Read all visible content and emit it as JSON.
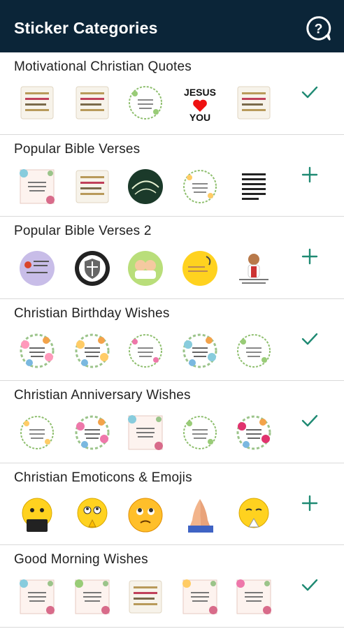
{
  "appbar": {
    "title": "Sticker Categories",
    "help_icon": "help-chat-icon",
    "background": "#0b2538"
  },
  "accent": "#1f8a73",
  "categories": [
    {
      "title": "Motivational Christian Quotes",
      "action": "added",
      "stickers": [
        {
          "label": "",
          "kind": "quote-card"
        },
        {
          "label": "Where GOD guides, He provides",
          "kind": "quote-card"
        },
        {
          "label": "",
          "kind": "wreath"
        },
        {
          "label": "JESUS ♥ YOU",
          "kind": "jesus-you"
        },
        {
          "label": "JESUS LOVES ME",
          "kind": "quote-card"
        }
      ]
    },
    {
      "title": "Popular Bible Verses",
      "action": "add",
      "stickers": [
        {
          "label": "",
          "kind": "floral-card"
        },
        {
          "label": "",
          "kind": "quote-card"
        },
        {
          "label": "",
          "kind": "chalk-circle"
        },
        {
          "label": "",
          "kind": "wreath"
        },
        {
          "label": "",
          "kind": "text-card"
        }
      ]
    },
    {
      "title": "Popular Bible Verses 2",
      "action": "add",
      "stickers": [
        {
          "label": "",
          "kind": "purple-circle"
        },
        {
          "label": "",
          "kind": "shield-circle"
        },
        {
          "label": "",
          "kind": "kids-circle"
        },
        {
          "label": "",
          "kind": "yellow-circle"
        },
        {
          "label": "",
          "kind": "jesus-figure"
        }
      ]
    },
    {
      "title": "Christian Birthday Wishes",
      "action": "added",
      "stickers": [
        {
          "label": "",
          "kind": "floral-wreath"
        },
        {
          "label": "",
          "kind": "floral-wreath"
        },
        {
          "label": "",
          "kind": "wreath"
        },
        {
          "label": "",
          "kind": "floral-wreath"
        },
        {
          "label": "",
          "kind": "wreath"
        }
      ]
    },
    {
      "title": "Christian Anniversary Wishes",
      "action": "added",
      "stickers": [
        {
          "label": "",
          "kind": "wreath"
        },
        {
          "label": "",
          "kind": "floral-wreath"
        },
        {
          "label": "",
          "kind": "floral-card"
        },
        {
          "label": "",
          "kind": "wreath"
        },
        {
          "label": "",
          "kind": "pink-wreath"
        }
      ]
    },
    {
      "title": "Christian Emoticons & Emojis",
      "action": "add",
      "stickers": [
        {
          "label": "",
          "kind": "emoji-bible"
        },
        {
          "label": "",
          "kind": "emoji-pray"
        },
        {
          "label": "",
          "kind": "emoji-hope"
        },
        {
          "label": "",
          "kind": "praying-hands"
        },
        {
          "label": "",
          "kind": "emoji-pray2"
        }
      ]
    },
    {
      "title": "Good Morning Wishes",
      "action": "added",
      "stickers": [
        {
          "label": "",
          "kind": "floral-card"
        },
        {
          "label": "",
          "kind": "floral-card"
        },
        {
          "label": "",
          "kind": "quote-card"
        },
        {
          "label": "",
          "kind": "floral-card"
        },
        {
          "label": "",
          "kind": "floral-card"
        }
      ]
    }
  ]
}
